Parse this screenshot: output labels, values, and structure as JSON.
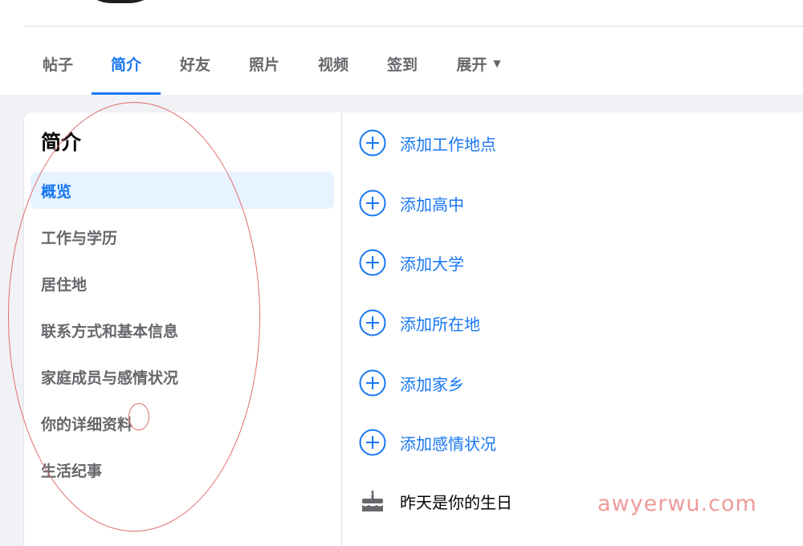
{
  "tabs": [
    {
      "label": "帖子"
    },
    {
      "label": "简介"
    },
    {
      "label": "好友"
    },
    {
      "label": "照片"
    },
    {
      "label": "视频"
    },
    {
      "label": "签到"
    },
    {
      "label": "展开"
    }
  ],
  "about": {
    "title": "简介",
    "nav": [
      {
        "label": "概览"
      },
      {
        "label": "工作与学历"
      },
      {
        "label": "居住地"
      },
      {
        "label": "联系方式和基本信息"
      },
      {
        "label": "家庭成员与感情状况"
      },
      {
        "label": "你的详细资料"
      },
      {
        "label": "生活纪事"
      }
    ],
    "actions": [
      {
        "label": "添加工作地点",
        "icon": "add-circle-icon"
      },
      {
        "label": "添加高中",
        "icon": "add-circle-icon"
      },
      {
        "label": "添加大学",
        "icon": "add-circle-icon"
      },
      {
        "label": "添加所在地",
        "icon": "add-circle-icon"
      },
      {
        "label": "添加家乡",
        "icon": "add-circle-icon"
      },
      {
        "label": "添加感情状况",
        "icon": "add-circle-icon"
      }
    ],
    "birthday": {
      "label": "昨天是你的生日",
      "icon": "birthday-cake-icon"
    }
  },
  "watermark": "awyerwu.com",
  "colors": {
    "accent": "#1877f2",
    "active_bg": "#e7f3ff",
    "annotation": "#e06b6b"
  }
}
